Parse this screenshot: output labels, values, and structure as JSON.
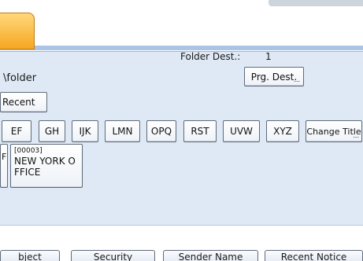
{
  "folder_dest": {
    "label": "Folder Dest.:",
    "count": "1"
  },
  "path": "\\folder",
  "prg_dest": {
    "label": "Prg. Dest.",
    "dots": "..."
  },
  "recent": "Recent",
  "alpha_tabs": [
    "EF",
    "GH",
    "IJK",
    "LMN",
    "OPQ",
    "RST",
    "UVW",
    "XYZ"
  ],
  "change_title": {
    "label": "Change Title",
    "dots": "..."
  },
  "destinations": [
    {
      "id": "[00003]",
      "name": "NEW YORK OFFICE"
    }
  ],
  "left_card_fragment": "F",
  "bottom_tabs": [
    "bject",
    "Security",
    "Sender Name",
    "Recent Notice"
  ],
  "colors": {
    "panel": "#dfe9f5",
    "tab_orange": "#f5a722",
    "accent_blue": "#aac4e6"
  }
}
